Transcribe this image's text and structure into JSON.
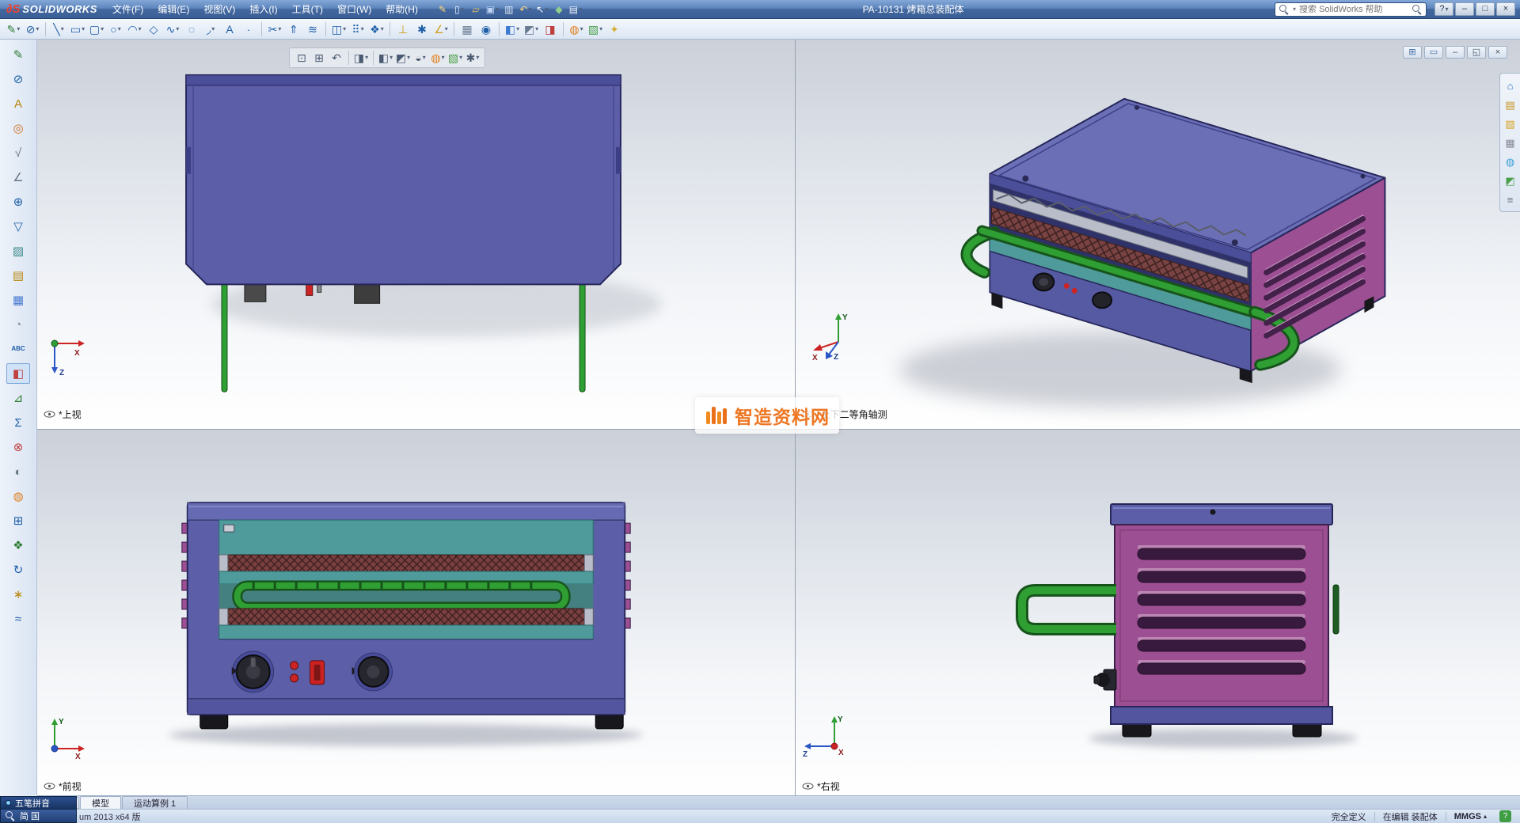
{
  "ui": {
    "drop": "▾"
  },
  "window": {
    "logo_mark": "∂S",
    "logo_text": "SOLIDWORKS",
    "title": "PA-10131 烤箱总装配体",
    "search_placeholder": "搜索 SolidWorks 帮助",
    "menus": [
      {
        "name": "menu-file",
        "glyph": "文件(F)",
        "cls": "menu"
      },
      {
        "name": "menu-edit",
        "glyph": "编辑(E)",
        "cls": "menu"
      },
      {
        "name": "menu-view",
        "glyph": "视图(V)",
        "cls": "menu"
      },
      {
        "name": "menu-insert",
        "glyph": "插入(I)",
        "cls": "menu"
      },
      {
        "name": "menu-tools",
        "glyph": "工具(T)",
        "cls": "menu"
      },
      {
        "name": "menu-window",
        "glyph": "窗口(W)",
        "cls": "menu"
      },
      {
        "name": "menu-help",
        "glyph": "帮助(H)",
        "cls": "menu"
      }
    ],
    "quick_icons": [
      {
        "name": "edit-sketch-icon",
        "glyph": "✎",
        "color": "#ffd37a"
      },
      {
        "name": "new-document-icon",
        "glyph": "▯",
        "color": "#eaf1ff",
        "drop": true
      },
      {
        "name": "open-icon",
        "glyph": "▱",
        "color": "#f3c95c"
      },
      {
        "name": "save-icon",
        "glyph": "▣",
        "color": "#bcd4f5",
        "drop": true
      },
      {
        "name": "print-icon",
        "glyph": "▥",
        "color": "#dbe5f2"
      },
      {
        "name": "undo-icon",
        "glyph": "↶",
        "color": "#ffd37a",
        "drop": true
      },
      {
        "name": "select-icon",
        "glyph": "↖",
        "color": "#ffffff",
        "drop": true
      },
      {
        "name": "rebuild-icon",
        "glyph": "◆",
        "color": "#8fd08f"
      },
      {
        "name": "options-icon",
        "glyph": "▤",
        "color": "#e8eefc",
        "drop": true
      }
    ],
    "controls": [
      {
        "name": "help-button",
        "glyph": "?",
        "cls": "winbtn",
        "drop": true
      },
      {
        "name": "minimize-button",
        "glyph": "–",
        "cls": "winbtn"
      },
      {
        "name": "maximize-button",
        "glyph": "□",
        "cls": "winbtn"
      },
      {
        "name": "close-button",
        "glyph": "×",
        "cls": "winbtn"
      }
    ]
  },
  "toolbar": {
    "icons": [
      {
        "name": "sketch-icon",
        "glyph": "✎",
        "color": "#2e7d32",
        "drop": true
      },
      {
        "name": "smart-dimension-icon",
        "glyph": "⊘",
        "color": "#1f5fa8",
        "drop": true
      },
      {
        "sep": true
      },
      {
        "name": "line-icon",
        "glyph": "╲",
        "color": "#1f5fa8",
        "drop": true
      },
      {
        "name": "rectangle-icon",
        "glyph": "▭",
        "color": "#1f5fa8",
        "drop": true
      },
      {
        "name": "slot-icon",
        "glyph": "▢",
        "color": "#1f5fa8",
        "drop": true
      },
      {
        "name": "circle-icon",
        "glyph": "○",
        "color": "#1f5fa8",
        "drop": true
      },
      {
        "name": "arc-icon",
        "glyph": "◠",
        "color": "#1f5fa8",
        "drop": true
      },
      {
        "name": "polygon-icon",
        "glyph": "◇",
        "color": "#1f5fa8"
      },
      {
        "name": "spline-icon",
        "glyph": "∿",
        "color": "#1f5fa8",
        "drop": true
      },
      {
        "name": "ellipse-icon",
        "glyph": "◌",
        "color": "#1f5fa8"
      },
      {
        "name": "fillet-icon",
        "glyph": "◞",
        "color": "#1f5fa8",
        "drop": true
      },
      {
        "name": "sketch-text-icon",
        "glyph": "A",
        "color": "#1f5fa8"
      },
      {
        "name": "point-icon",
        "glyph": "·",
        "color": "#1f5fa8"
      },
      {
        "sep": true
      },
      {
        "name": "trim-entities-icon",
        "glyph": "✂",
        "color": "#1f5fa8",
        "drop": true
      },
      {
        "name": "convert-entities-icon",
        "glyph": "⇑",
        "color": "#1f5fa8"
      },
      {
        "name": "offset-entities-icon",
        "glyph": "≋",
        "color": "#1f5fa8"
      },
      {
        "sep": true
      },
      {
        "name": "mirror-entities-icon",
        "glyph": "◫",
        "color": "#1f5fa8",
        "drop": true
      },
      {
        "name": "linear-pattern-icon",
        "glyph": "⠿",
        "color": "#1f5fa8",
        "drop": true
      },
      {
        "name": "move-entities-icon",
        "glyph": "❖",
        "color": "#1f5fa8",
        "drop": true
      },
      {
        "sep": true
      },
      {
        "name": "display-relations-icon",
        "glyph": "⊥",
        "color": "#d0a020"
      },
      {
        "name": "repair-sketch-icon",
        "glyph": "✱",
        "color": "#1f5fa8"
      },
      {
        "name": "quick-snaps-icon",
        "glyph": "∠",
        "color": "#d0a020",
        "drop": true
      },
      {
        "sep": true
      },
      {
        "name": "grid-icon",
        "glyph": "▦",
        "color": "#6b7c92"
      },
      {
        "name": "snap-icon",
        "glyph": "◉",
        "color": "#1f5fa8"
      },
      {
        "sep": true
      },
      {
        "name": "view-orientation-icon",
        "glyph": "◧",
        "color": "#3a7ad0",
        "drop": true
      },
      {
        "name": "display-style-icon",
        "glyph": "◩",
        "color": "#6b7c92",
        "drop": true
      },
      {
        "name": "section-view-icon",
        "glyph": "◨",
        "color": "#c04040"
      },
      {
        "sep": true
      },
      {
        "name": "edit-appearance-icon",
        "glyph": "◍",
        "color": "#e08020",
        "drop": true
      },
      {
        "name": "apply-scene-icon",
        "glyph": "▧",
        "color": "#4aa04a",
        "drop": true
      },
      {
        "name": "instant3d-icon",
        "glyph": "✦",
        "color": "#d4af37"
      }
    ]
  },
  "left_toolbar": {
    "icons": [
      {
        "name": "layout-sketch-icon",
        "glyph": "✎",
        "color": "#2e7d32"
      },
      {
        "name": "smart-dimension-icon",
        "glyph": "⊘",
        "color": "#1f5fa8"
      },
      {
        "name": "note-icon",
        "glyph": "A",
        "color": "#b8860b"
      },
      {
        "name": "balloon-icon",
        "glyph": "◎",
        "color": "#d07020"
      },
      {
        "name": "surface-finish-icon",
        "glyph": "√",
        "color": "#667788"
      },
      {
        "name": "weld-symbol-icon",
        "glyph": "∠",
        "color": "#667788"
      },
      {
        "name": "geometric-tolerance-icon",
        "glyph": "⊕",
        "color": "#1f5fa8"
      },
      {
        "name": "datum-feature-icon",
        "glyph": "▽",
        "color": "#1f5fa8"
      },
      {
        "name": "area-hatch-icon",
        "glyph": "▨",
        "color": "#3a8a8a"
      },
      {
        "name": "blocks-icon",
        "glyph": "▤",
        "color": "#b8860b"
      },
      {
        "name": "tables-icon",
        "glyph": "▦",
        "color": "#4a7ad0"
      },
      {
        "name": "revision-cloud-icon",
        "glyph": "◔",
        "color": "#8899aa"
      },
      {
        "name": "spell-checker-icon",
        "glyph": "ABC",
        "color": "#1f5fa8",
        "cls": "small"
      },
      {
        "name": "section-view-icon",
        "glyph": "◧",
        "color": "#c04040",
        "active": true
      },
      {
        "name": "measure-icon",
        "glyph": "⊿",
        "color": "#2e7d32"
      },
      {
        "name": "mass-properties-icon",
        "glyph": "Σ",
        "color": "#1f5fa8"
      },
      {
        "name": "interference-detection-icon",
        "glyph": "⊗",
        "color": "#c04040"
      },
      {
        "name": "hide-show-icon",
        "glyph": "◐",
        "color": "#667788"
      },
      {
        "name": "edit-appearance-icon",
        "glyph": "◍",
        "color": "#e08020"
      },
      {
        "name": "mate-icon",
        "glyph": "⊞",
        "color": "#1f5fa8"
      },
      {
        "name": "move-component-icon",
        "glyph": "❖",
        "color": "#2e7d32"
      },
      {
        "name": "rotate-component-icon",
        "glyph": "↻",
        "color": "#1f5fa8"
      },
      {
        "name": "exploded-view-icon",
        "glyph": "∗",
        "color": "#b8860b"
      },
      {
        "name": "simulation-icon",
        "glyph": "≈",
        "color": "#1f5fa8"
      }
    ]
  },
  "headsup": {
    "icons": [
      {
        "name": "zoom-fit-icon",
        "glyph": "⊡",
        "color": "#4a5a70"
      },
      {
        "name": "zoom-area-icon",
        "glyph": "⊞",
        "color": "#4a5a70"
      },
      {
        "name": "previous-view-icon",
        "glyph": "↶",
        "color": "#4a5a70"
      },
      {
        "sep": true
      },
      {
        "name": "section-view-icon",
        "glyph": "◨",
        "color": "#4a5a70",
        "drop": true
      },
      {
        "sep": true
      },
      {
        "name": "view-orientation-icon",
        "glyph": "◧",
        "color": "#4a5a70",
        "drop": true
      },
      {
        "name": "display-style-icon",
        "glyph": "◩",
        "color": "#4a5a70",
        "drop": true
      },
      {
        "name": "hide-show-items-icon",
        "glyph": "◒",
        "color": "#4a5a70",
        "drop": true
      },
      {
        "name": "edit-appearance-icon",
        "glyph": "◍",
        "color": "#e08020",
        "drop": true
      },
      {
        "name": "apply-scene-icon",
        "glyph": "▧",
        "color": "#4aa04a",
        "drop": true
      },
      {
        "name": "view-settings-icon",
        "glyph": "✱",
        "color": "#4a5a70",
        "drop": true
      }
    ]
  },
  "doc_controls": {
    "icons": [
      {
        "name": "viewport-layout-icon",
        "glyph": "⊞",
        "color": "#3a6aa0"
      },
      {
        "name": "viewport-single-icon",
        "glyph": "▭",
        "color": "#3a6aa0"
      },
      {
        "name": "document-minimize-icon",
        "glyph": "–",
        "color": "#445566"
      },
      {
        "name": "document-restore-icon",
        "glyph": "◱",
        "color": "#445566"
      },
      {
        "name": "document-close-icon",
        "glyph": "×",
        "color": "#445566"
      }
    ]
  },
  "taskpane": {
    "icons": [
      {
        "name": "resources-icon",
        "glyph": "⌂",
        "color": "#2a6fbd"
      },
      {
        "name": "design-library-icon",
        "glyph": "▤",
        "color": "#c69320"
      },
      {
        "name": "file-explorer-icon",
        "glyph": "▧",
        "color": "#d8a01f"
      },
      {
        "name": "view-palette-icon",
        "glyph": "▦",
        "color": "#8a8a9a"
      },
      {
        "name": "appearances-icon",
        "glyph": "◍",
        "color": "#3aa0d8"
      },
      {
        "name": "scenes-icon",
        "glyph": "◩",
        "color": "#4aa04a"
      },
      {
        "name": "custom-properties-icon",
        "glyph": "≡",
        "color": "#667788"
      }
    ]
  },
  "viewports": [
    {
      "label": "*上视"
    },
    {
      "label": "*上下二等角轴测"
    },
    {
      "label": "*前视"
    },
    {
      "label": "*右视"
    }
  ],
  "triad": {
    "x": "X",
    "y": "Y",
    "z": "Z"
  },
  "watermark": {
    "text": "智造资料网"
  },
  "tabs": {
    "prev": "◂",
    "next": "▸",
    "items": [
      {
        "label": "模型"
      },
      {
        "label": "运动算例 1"
      }
    ]
  },
  "status": {
    "version": "um 2013 x64 版",
    "defined": "完全定义",
    "mode": "在编辑 装配体",
    "units": "MMGS",
    "units_arrow": "▴",
    "help": "?"
  },
  "ime": {
    "row1": "五笔拼音",
    "row2": "简 国"
  },
  "colors": {
    "body_purple": "#5c5fa8",
    "side_magenta": "#9c4f92",
    "handle_green": "#2f9e33",
    "tray_teal": "#4f9a9b",
    "watermark_orange": "#ee7622",
    "titlebar_blue": "#44699f"
  }
}
